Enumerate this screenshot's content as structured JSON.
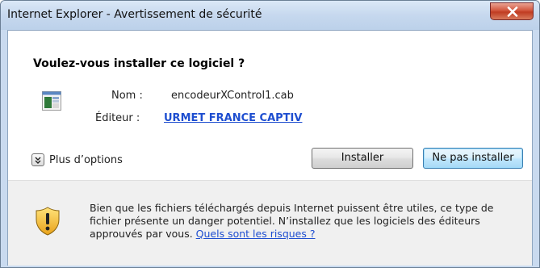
{
  "window": {
    "title": "Internet Explorer - Avertissement de sécurité"
  },
  "dialog": {
    "question": "Voulez-vous installer ce logiciel ?",
    "name_label": "Nom :",
    "name_value": "encodeurXControl1.cab",
    "publisher_label": "Éditeur :",
    "publisher_value": "URMET FRANCE CAPTIV",
    "more_options": "Plus d’options",
    "install_button": "Installer",
    "no_install_button": "Ne pas installer"
  },
  "warning": {
    "text": "Bien que les fichiers téléchargés depuis Internet puissent être utiles, ce type de fichier présente un danger potentiel. N’installez que les logiciels des éditeurs approuvés par vous. ",
    "link": "Quels sont les risques ?"
  },
  "icons": {
    "app": "application-file-icon",
    "shield": "warning-shield-icon",
    "close": "close-icon",
    "expand": "chevron-down-icon"
  },
  "colors": {
    "link": "#1e4ed0",
    "close_button": "#c03c22",
    "default_button_border": "#3c7fb1"
  }
}
